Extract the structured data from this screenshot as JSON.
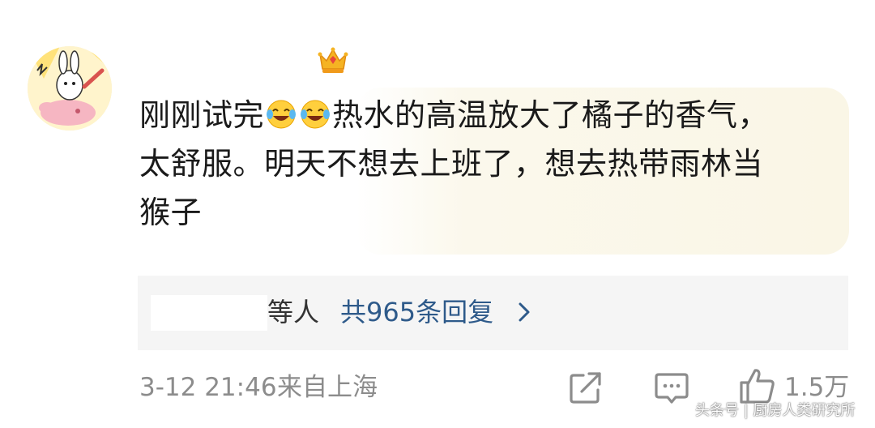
{
  "comment": {
    "line1_part1": "刚刚试完",
    "line1_part2": "热水的高温放大了橘子的香气，",
    "line2": "太舒服。明天不想去上班了，想去热带雨林当",
    "line3": "猴子",
    "emoji_names": [
      "laughing-tears-icon",
      "laughing-tears-icon"
    ]
  },
  "replies": {
    "who": "等人",
    "count_label": "共965条回复"
  },
  "meta": {
    "time": "3-12 21:46",
    "location": "来自上海",
    "like_count": "1.5万"
  },
  "watermark": "头条号 | 厨房人类研究所",
  "colors": {
    "reply_link": "#2e5a8a",
    "meta_gray": "#8c8c8c",
    "reply_bg": "#f5f5f5"
  }
}
